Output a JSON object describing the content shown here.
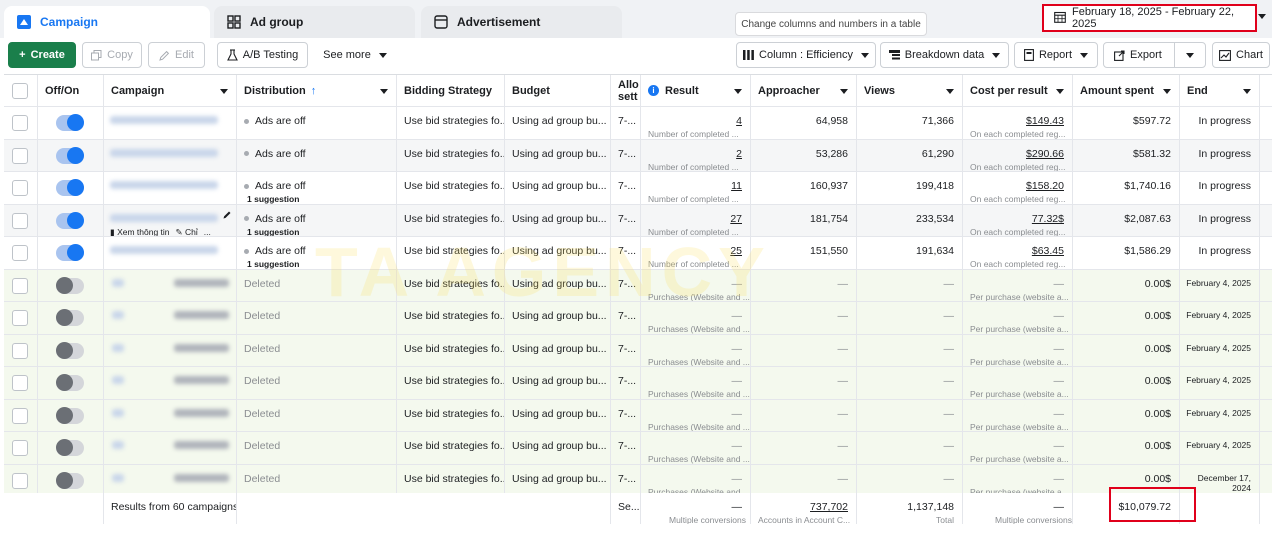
{
  "tabs": [
    {
      "label": "Campaign",
      "icon": "campaign-icon",
      "active": true
    },
    {
      "label": "Ad group",
      "icon": "ad-group-icon",
      "active": false
    },
    {
      "label": "Advertisement",
      "icon": "advertisement-icon",
      "active": false
    }
  ],
  "tooltip": "Change columns and numbers in a table",
  "date_range": "February 18, 2025 - February 22, 2025",
  "toolbar": {
    "create": "Create",
    "copy": "Copy",
    "edit": "Edit",
    "ab_testing": "A/B Testing",
    "see_more": "See more",
    "column": "Column : Efficiency",
    "breakdown": "Breakdown data",
    "report": "Report",
    "export": "Export",
    "chart": "Chart"
  },
  "columns": {
    "offon": "Off/On",
    "campaign": "Campaign",
    "distribution": "Distribution",
    "bidding": "Bidding Strategy",
    "budget": "Budget",
    "allo": "Allo",
    "allo2": "sett",
    "result": "Result",
    "approacher": "Approacher",
    "views": "Views",
    "cost": "Cost per result",
    "amount": "Amount spent",
    "end": "End"
  },
  "rows": [
    {
      "on": true,
      "distribution": "Ads are off",
      "suggestion": "",
      "bidding": "Use bid strategies fo...",
      "budget": "Using ad group bu...",
      "allo": "7-...",
      "result": "4",
      "result_sub": "Number of completed ...",
      "approacher": "64,958",
      "views": "71,366",
      "cost": "$149.43",
      "cost_sub": "On each completed reg...",
      "amount": "$597.72",
      "end": "In progress"
    },
    {
      "on": true,
      "distribution": "Ads are off",
      "suggestion": "",
      "bidding": "Use bid strategies fo...",
      "budget": "Using ad group bu...",
      "allo": "7-...",
      "result": "2",
      "result_sub": "Number of completed ...",
      "approacher": "53,286",
      "views": "61,290",
      "cost": "$290.66",
      "cost_sub": "On each completed reg...",
      "amount": "$581.32",
      "end": "In progress"
    },
    {
      "on": true,
      "distribution": "Ads are off",
      "suggestion": "1 suggestion",
      "bidding": "Use bid strategies fo...",
      "budget": "Using ad group bu...",
      "allo": "7-...",
      "result": "11",
      "result_sub": "Number of completed ...",
      "approacher": "160,937",
      "views": "199,418",
      "cost": "$158.20",
      "cost_sub": "On each completed reg...",
      "amount": "$1,740.16",
      "end": "In progress"
    },
    {
      "on": true,
      "distribution": "Ads are off",
      "suggestion": "1 suggestion",
      "bidding": "Use bid strategies fo...",
      "budget": "Using ad group bu...",
      "allo": "7-...",
      "result": "27",
      "result_sub": "Number of completed ...",
      "approacher": "181,754",
      "views": "233,534",
      "cost": "77.32$",
      "cost_sub": "On each completed reg...",
      "amount": "$2,087.63",
      "end": "In progress",
      "hover_links": [
        "Xem thông tin",
        "Chỉ",
        "..."
      ]
    },
    {
      "on": true,
      "distribution": "Ads are off",
      "suggestion": "1 suggestion",
      "bidding": "Use bid strategies fo...",
      "budget": "Using ad group bu...",
      "allo": "7-...",
      "result": "25",
      "result_sub": "Number of completed ...",
      "approacher": "151,550",
      "views": "191,634",
      "cost": "$63.45",
      "cost_sub": "On each completed reg...",
      "amount": "$1,586.29",
      "end": "In progress"
    },
    {
      "on": false,
      "distribution": "Deleted",
      "suggestion": "",
      "bidding": "Use bid strategies fo...",
      "budget": "Using ad group bu...",
      "allo": "7-...",
      "result": "—",
      "result_sub": "Purchases (Website and ...",
      "approacher": "—",
      "views": "—",
      "cost": "—",
      "cost_sub": "Per purchase (website a...",
      "amount": "0.00$",
      "end": "February 4, 2025"
    },
    {
      "on": false,
      "distribution": "Deleted",
      "suggestion": "",
      "bidding": "Use bid strategies fo...",
      "budget": "Using ad group bu...",
      "allo": "7-...",
      "result": "—",
      "result_sub": "Purchases (Website and ...",
      "approacher": "—",
      "views": "—",
      "cost": "—",
      "cost_sub": "Per purchase (website a...",
      "amount": "0.00$",
      "end": "February 4, 2025"
    },
    {
      "on": false,
      "distribution": "Deleted",
      "suggestion": "",
      "bidding": "Use bid strategies fo...",
      "budget": "Using ad group bu...",
      "allo": "7-...",
      "result": "—",
      "result_sub": "Purchases (Website and ...",
      "approacher": "—",
      "views": "—",
      "cost": "—",
      "cost_sub": "Per purchase (website a...",
      "amount": "0.00$",
      "end": "February 4, 2025"
    },
    {
      "on": false,
      "distribution": "Deleted",
      "suggestion": "",
      "bidding": "Use bid strategies fo...",
      "budget": "Using ad group bu...",
      "allo": "7-...",
      "result": "—",
      "result_sub": "Purchases (Website and ...",
      "approacher": "—",
      "views": "—",
      "cost": "—",
      "cost_sub": "Per purchase (website a...",
      "amount": "0.00$",
      "end": "February 4, 2025"
    },
    {
      "on": false,
      "distribution": "Deleted",
      "suggestion": "",
      "bidding": "Use bid strategies fo...",
      "budget": "Using ad group bu...",
      "allo": "7-...",
      "result": "—",
      "result_sub": "Purchases (Website and ...",
      "approacher": "—",
      "views": "—",
      "cost": "—",
      "cost_sub": "Per purchase (website a...",
      "amount": "0.00$",
      "end": "February 4, 2025"
    },
    {
      "on": false,
      "distribution": "Deleted",
      "suggestion": "",
      "bidding": "Use bid strategies fo...",
      "budget": "Using ad group bu...",
      "allo": "7-...",
      "result": "—",
      "result_sub": "Purchases (Website and ...",
      "approacher": "—",
      "views": "—",
      "cost": "—",
      "cost_sub": "Per purchase (website a...",
      "amount": "0.00$",
      "end": "February 4, 2025"
    },
    {
      "on": false,
      "distribution": "Deleted",
      "suggestion": "",
      "bidding": "Use bid strategies fo...",
      "budget": "Using ad group bu...",
      "allo": "7-...",
      "result": "—",
      "result_sub": "Purchases (Website and ...",
      "approacher": "—",
      "views": "—",
      "cost": "—",
      "cost_sub": "Per purchase (website a...",
      "amount": "0.00$",
      "end": "December 17, 2024"
    }
  ],
  "footer": {
    "results": "Results from 60 campaigns",
    "allo": "Se...",
    "result": "—",
    "result_sub": "Multiple conversions",
    "approacher": "737,702",
    "approacher_sub": "Accounts in Account C...",
    "views": "1,137,148",
    "views_sub": "Total",
    "cost": "—",
    "cost_sub": "Multiple conversions",
    "amount": "$10,079.72"
  },
  "watermark": "TA AGENCY",
  "colors": {
    "accent": "#1877f2",
    "create": "#1a7f4b",
    "highlight": "#e0001b",
    "deleted_row": "#f4f9ee"
  }
}
